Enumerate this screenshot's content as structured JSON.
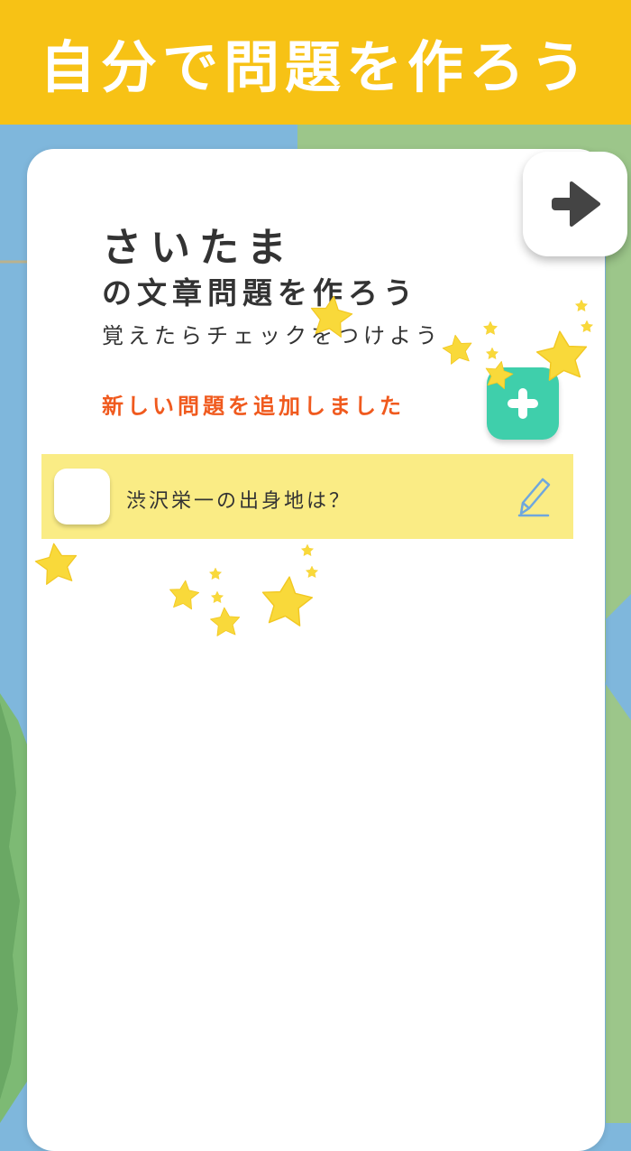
{
  "banner": {
    "title": "自分で問題を作ろう"
  },
  "card": {
    "prefecture": "さいたま",
    "subtitle": "の文章問題を作ろう",
    "hint": "覚えたらチェックをつけよう",
    "status": "新しい問題を追加しました"
  },
  "questions": [
    {
      "text": "渋沢栄一の出身地は？",
      "checked": false
    }
  ],
  "icons": {
    "next": "arrow-right-icon",
    "add": "plus-icon",
    "edit": "pencil-icon",
    "decoration": "star-icon"
  },
  "colors": {
    "banner": "#f7c215",
    "add_button": "#3fcfab",
    "status_text": "#f05a1e",
    "question_row": "#faec85",
    "star": "#f9d93a"
  }
}
